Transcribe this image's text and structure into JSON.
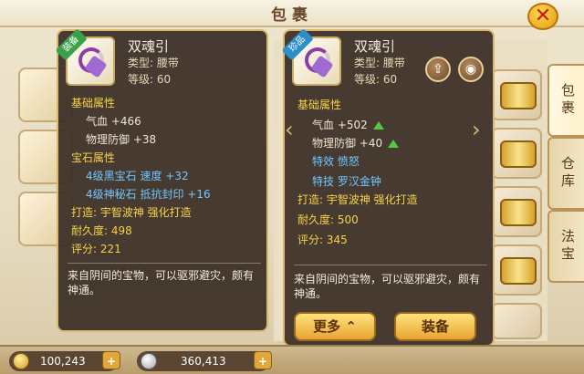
{
  "window": {
    "title": "包裹"
  },
  "side_tabs": [
    "包裹",
    "仓库",
    "法宝"
  ],
  "currency": {
    "gold": "100,243",
    "silver": "360,413"
  },
  "left_item": {
    "badge": "装备",
    "name": "双魂引",
    "type": "类型: 腰带",
    "level": "等级: 60",
    "base_title": "基础属性",
    "base": [
      "气血 +466",
      "物理防御 +38"
    ],
    "gem_title": "宝石属性",
    "gems": [
      "4级黑宝石  速度 +32",
      "4级神秘石  抵抗封印 +16"
    ],
    "forge": "打造:  宇智波神    强化打造",
    "durability": "耐久度:  498",
    "score": "评分:  221",
    "description": "来自阴间的宝物，可以驱邪避灾，颇有神通。"
  },
  "right_item": {
    "badge": "珍品",
    "name": "双魂引",
    "type": "类型: 腰带",
    "level": "等级: 60",
    "base_title": "基础属性",
    "base": [
      "气血  +502",
      "物理防御  +40"
    ],
    "effects": [
      "特效  愤怒",
      "特技  罗汉金钟"
    ],
    "forge": "打造:  宇智波神    强化打造",
    "durability": "耐久度:  500",
    "score": "评分:  345",
    "description": "来自阴间的宝物，可以驱邪避灾，颇有神通。",
    "more_button": "更多",
    "equip_button": "装备"
  },
  "colors": {
    "panel_bg": "#3a2d26",
    "highlight": "#f6d44a",
    "gem_text": "#6fc8ff",
    "up_arrow": "#51c93f"
  }
}
